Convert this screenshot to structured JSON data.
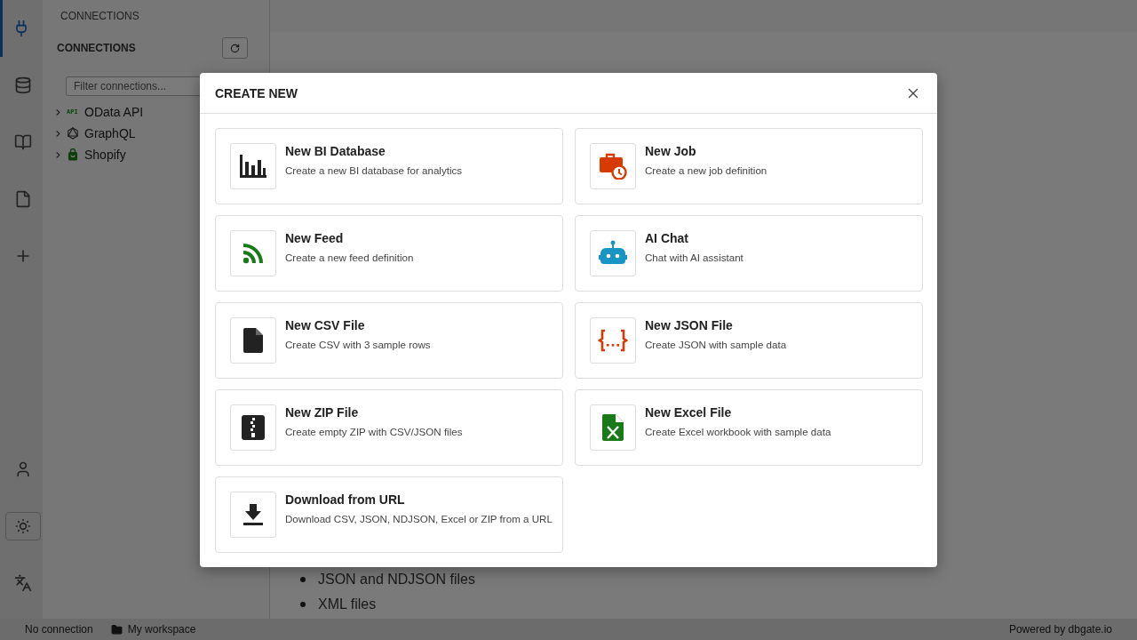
{
  "activity_bar": {
    "top": [
      {
        "kind": "connections",
        "selected": true
      },
      {
        "kind": "database",
        "selected": false
      },
      {
        "kind": "book",
        "selected": false
      },
      {
        "kind": "file",
        "selected": false
      },
      {
        "kind": "add",
        "selected": false
      }
    ],
    "bottom": [
      {
        "kind": "user",
        "selected": false
      },
      {
        "kind": "theme",
        "selected": true
      },
      {
        "kind": "language",
        "selected": false
      }
    ]
  },
  "connections_panel": {
    "title": "CONNECTIONS",
    "header": "CONNECTIONS",
    "filter": {
      "placeholder": "Filter connections..."
    },
    "items": [
      {
        "kind": "api",
        "badge": "API",
        "label": "OData API",
        "expanded": false
      },
      {
        "kind": "graphql",
        "label": "GraphQL",
        "expanded": false
      },
      {
        "kind": "shopify",
        "label": "Shopify",
        "expanded": false
      }
    ]
  },
  "main": {
    "list": [
      "JSON and NDJSON files",
      "XML files"
    ]
  },
  "dialog": {
    "title": "CREATE NEW",
    "items": [
      {
        "kind": "database",
        "title": "New BI Database",
        "description": "Create a new BI database for analytics"
      },
      {
        "kind": "job",
        "title": "New Job",
        "description": "Create a new job definition"
      },
      {
        "kind": "feed",
        "title": "New Feed",
        "description": "Create a new feed definition"
      },
      {
        "kind": "chat",
        "title": "AI Chat",
        "description": "Chat with AI assistant"
      },
      {
        "kind": "csv",
        "title": "New CSV File",
        "description": "Create CSV with 3 sample rows"
      },
      {
        "kind": "json",
        "title": "New JSON File",
        "description": "Create JSON with sample data"
      },
      {
        "kind": "zip",
        "title": "New ZIP File",
        "description": "Create empty ZIP with CSV/JSON files"
      },
      {
        "kind": "excel",
        "title": "New Excel File",
        "description": "Create Excel workbook with sample data"
      },
      {
        "kind": "download",
        "title": "Download from URL",
        "description": "Download CSV, JSON, NDJSON, Excel or ZIP from a URL"
      }
    ]
  },
  "status_bar": {
    "connection": "No connection",
    "workspace": "My workspace",
    "powered": "Powered by dbgate.io"
  }
}
